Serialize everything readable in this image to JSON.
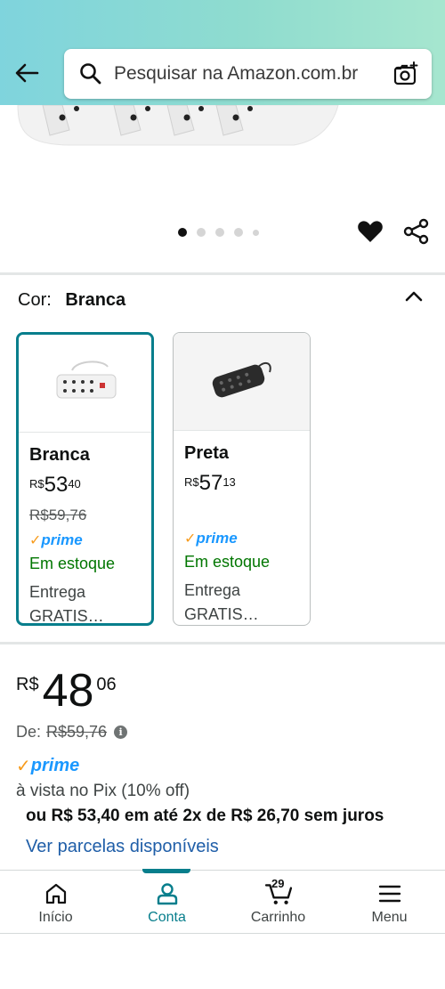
{
  "search": {
    "placeholder": "Pesquisar na Amazon.com.br"
  },
  "carousel": {
    "total_images": 5,
    "active_index": 0
  },
  "variation": {
    "label": "Cor:",
    "selected": "Branca",
    "options": [
      {
        "name": "Branca",
        "price_currency": "R$",
        "price_whole": "53",
        "price_fraction": "40",
        "list_price": "R$59,76",
        "prime": "prime",
        "stock": "Em estoque",
        "delivery": "Entrega GRATIS…",
        "selected": true
      },
      {
        "name": "Preta",
        "price_currency": "R$",
        "price_whole": "57",
        "price_fraction": "13",
        "list_price": "",
        "prime": "prime",
        "stock": "Em estoque",
        "delivery": "Entrega GRATIS…",
        "selected": false
      }
    ]
  },
  "price": {
    "currency": "R$",
    "whole": "48",
    "fraction": "06",
    "de_label": "De:",
    "list_price": "R$59,76",
    "prime": "prime",
    "pix_text": "à vista no Pix (10% off)",
    "installments": "ou R$ 53,40 em até 2x de R$ 26,70 sem juros",
    "installments_link": "Ver parcelas disponíveis"
  },
  "nav": {
    "items": [
      {
        "label": "Início",
        "icon": "home-icon"
      },
      {
        "label": "Conta",
        "icon": "account-icon",
        "active": true
      },
      {
        "label": "Carrinho",
        "icon": "cart-icon",
        "count": "29"
      },
      {
        "label": "Menu",
        "icon": "menu-icon"
      }
    ]
  },
  "colors": {
    "accent": "#077e8c",
    "link": "#1f5ea8",
    "in_stock": "#007600",
    "prime": "#1a98ff",
    "prime_check": "#f79b1c"
  }
}
